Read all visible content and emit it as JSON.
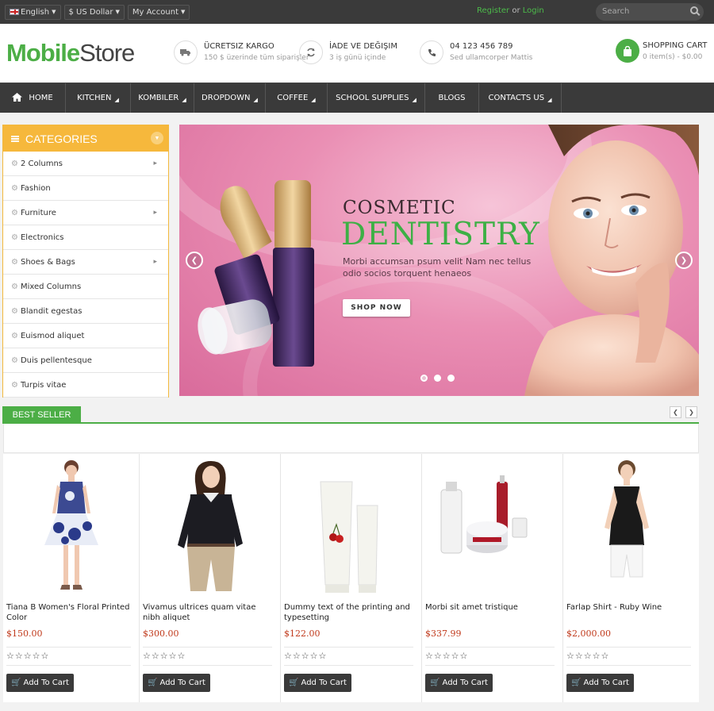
{
  "topbar": {
    "language": "English",
    "currency": "$ US Dollar",
    "account": "My Account",
    "register": "Register",
    "or": "or",
    "login": "Login",
    "search_placeholder": "Search"
  },
  "header": {
    "logo_part1": "Mobile",
    "logo_part2": "Store",
    "features": [
      {
        "title": "ÜCRETSIZ KARGO",
        "sub": "150 $ üzerinde tüm siparişler",
        "icon": "truck-icon"
      },
      {
        "title": "İADE VE DEĞIŞIM",
        "sub": "3 iş günü içinde",
        "icon": "refresh-icon"
      },
      {
        "title": "04 123 456 789",
        "sub": "Sed ullamcorper Mattis",
        "icon": "phone-icon"
      }
    ],
    "cart_title": "SHOPPING CART",
    "cart_sub": "0 item(s) - $0.00"
  },
  "nav": {
    "items": [
      {
        "label": "HOME"
      },
      {
        "label": "KITCHEN"
      },
      {
        "label": "KOMBILER"
      },
      {
        "label": "DROPDOWN"
      },
      {
        "label": "COFFEE"
      },
      {
        "label": "SCHOOL SUPPLIES"
      },
      {
        "label": "BLOGS"
      },
      {
        "label": "CONTACTS US"
      }
    ]
  },
  "categories": {
    "title": "CATEGORIES",
    "items": [
      {
        "label": "2 Columns",
        "has_sub": true
      },
      {
        "label": "Fashion",
        "has_sub": false
      },
      {
        "label": "Furniture",
        "has_sub": true
      },
      {
        "label": "Electronics",
        "has_sub": false
      },
      {
        "label": "Shoes & Bags",
        "has_sub": true
      },
      {
        "label": "Mixed Columns",
        "has_sub": false
      },
      {
        "label": "Blandit egestas",
        "has_sub": false
      },
      {
        "label": "Euismod aliquet",
        "has_sub": false
      },
      {
        "label": "Duis pellentesque",
        "has_sub": false
      },
      {
        "label": "Turpis vitae",
        "has_sub": false
      }
    ]
  },
  "slider": {
    "line1": "COSMETIC",
    "line2": "DENTISTRY",
    "desc": "Morbi accumsan psum velit Nam nec tellus odio socios torquent henaeos",
    "button": "SHOP NOW",
    "slide_count": 3,
    "active_slide": 1
  },
  "best_seller": {
    "title": "BEST SELLER",
    "add_to_cart": "Add To Cart",
    "products": [
      {
        "name": "Tiana B Women's Floral Printed Color",
        "price": "$150.00",
        "rating": 0
      },
      {
        "name": "Vivamus ultrices quam vitae nibh aliquet",
        "price": "$300.00",
        "rating": 0
      },
      {
        "name": "Dummy text of the printing and typesetting",
        "price": "$122.00",
        "rating": 0
      },
      {
        "name": "Morbi sit amet tristique",
        "price": "$337.99",
        "rating": 0
      },
      {
        "name": "Farlap Shirt - Ruby Wine",
        "price": "$2,000.00",
        "rating": 0
      }
    ]
  },
  "colors": {
    "accent": "#4cae46",
    "categories": "#f6b83c",
    "dark": "#3a3a3a",
    "price": "#c0391b"
  }
}
